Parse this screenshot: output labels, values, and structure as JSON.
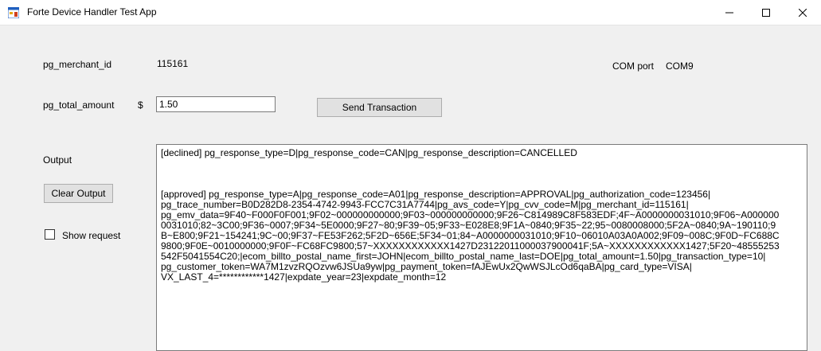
{
  "window": {
    "title": "Forte Device Handler Test App",
    "icon": "form-app-icon",
    "controls": [
      "minimize-icon",
      "maximize-icon",
      "close-icon"
    ]
  },
  "form": {
    "merchant_id_label": "pg_merchant_id",
    "merchant_id_value": "115161",
    "com_port_label": "COM port",
    "com_port_value": "COM9",
    "total_amount_label": "pg_total_amount",
    "currency_symbol": "$",
    "total_amount_value": "1.50",
    "send_button": "Send Transaction",
    "output_label": "Output",
    "clear_button": "Clear Output",
    "show_request_label": "Show request",
    "show_request_checked": false
  },
  "output": {
    "lines": [
      "[declined] pg_response_type=D|pg_response_code=CAN|pg_response_description=CANCELLED",
      "[approved] pg_response_type=A|pg_response_code=A01|pg_response_description=APPROVAL|pg_authorization_code=123456|",
      "pg_trace_number=B0D282D8-2354-4742-9943-FCC7C31A7744|pg_avs_code=Y|pg_cvv_code=M|pg_merchant_id=115161|",
      "pg_emv_data=9F40~F000F0F001;9F02~000000000000;9F03~000000000000;9F26~C814989C8F583EDF;4F~A0000000031010;9F06~A000000",
      "0031010;82~3C00;9F36~0007;9F34~5E0000;9F27~80;9F39~05;9F33~E028E8;9F1A~0840;9F35~22;95~0080008000;5F2A~0840;9A~190110;9",
      "B~E800;9F21~154241;9C~00;9F37~FE53F262;5F2D~656E;5F34~01;84~A0000000031010;9F10~06010A03A0A002;9F09~008C;9F0D~FC688C",
      "9800;9F0E~0010000000;9F0F~FC68FC9800;57~XXXXXXXXXXXX1427D23122011000037900041F;5A~XXXXXXXXXXXX1427;5F20~48555253",
      "542F5041554C20;|ecom_billto_postal_name_first=JOHN|ecom_billto_postal_name_last=DOE|pg_total_amount=1.50|pg_transaction_type=10|",
      "pg_customer_token=WA7M1zvzRQOzvw6JSUa9yw|pg_payment_token=fAJEwUx2QwWSJLcOd6qaBA|pg_card_type=VISA|",
      "VX_LAST_4=************1427|expdate_year=23|expdate_month=12"
    ]
  }
}
